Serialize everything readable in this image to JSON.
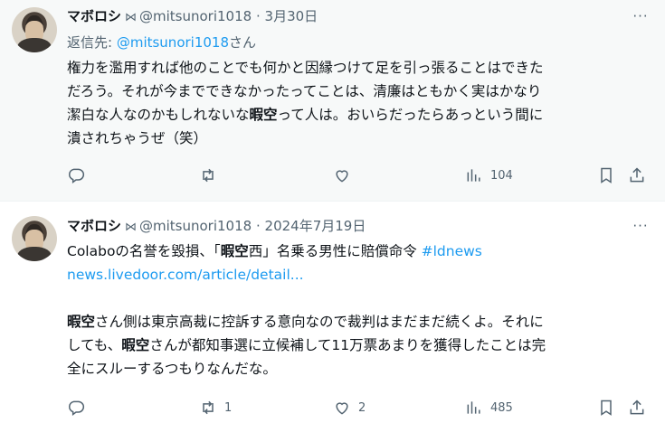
{
  "tweets": [
    {
      "author": "マボロシ",
      "badge": "⋈",
      "handle": "@mitsunori1018",
      "sep": "·",
      "date": "3月30日",
      "reply_prefix": "返信先: ",
      "reply_handle": "@mitsunori1018",
      "reply_suffix": "さん",
      "lines": [
        {
          "a": "権力を濫用すれば他のことでも何かと因縁つけて足を引っ張ることはできた"
        },
        {
          "a": "だろう。それが今までできなかったってことは、清廉はともかく実はかなり"
        },
        {
          "a": "潔白な人なのかもしれないな",
          "b": "暇空",
          "c": "って人は。おいらだったらあっという間に"
        },
        {
          "a": "潰されちゃうぜ（笑）"
        }
      ],
      "replies": "",
      "retweets": "",
      "likes": "",
      "views": "104"
    },
    {
      "author": "マボロシ",
      "badge": "⋈",
      "handle": "@mitsunori1018",
      "sep": "·",
      "date": "2024年7月19日",
      "line1_a": "Colaboの名誉を毀損、「",
      "line1_b": "暇空",
      "line1_c": "西」名乗る男性に賠償命令 ",
      "hashtag": "#ldnews",
      "url": "news.livedoor.com/article/detail...",
      "p2_lines": [
        {
          "b": "暇空",
          "c": "さん側は東京高裁に控訴する意向なので裁判はまだまだ続くよ。それに"
        },
        {
          "a": "しても、",
          "b": "暇空",
          "c": "さんが都知事選に立候補して11万票あまりを獲得したことは完"
        },
        {
          "a": "全にスルーするつもりなんだな。"
        }
      ],
      "replies": "",
      "retweets": "1",
      "likes": "2",
      "views": "485"
    }
  ],
  "icons": {
    "reply": "reply-icon",
    "retweet": "retweet-icon",
    "like": "heart-icon",
    "views": "views-icon",
    "bookmark": "bookmark-icon",
    "share": "share-icon",
    "more": "more-icon"
  },
  "more_glyph": "···"
}
